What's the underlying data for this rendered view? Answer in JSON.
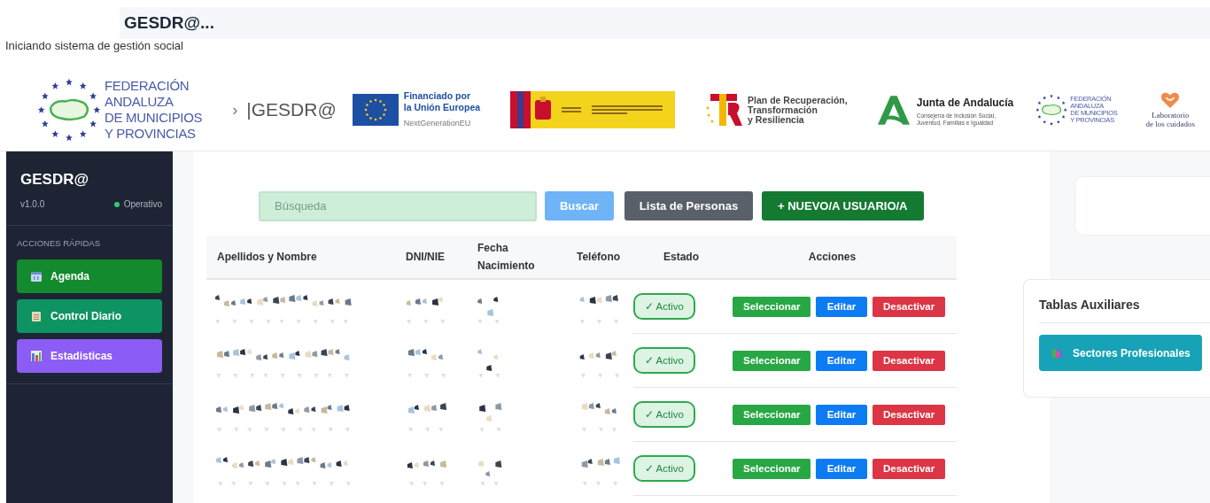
{
  "header": {
    "title": "GESDR@...",
    "subtitle": "Iniciando sistema de gestión social"
  },
  "logos": [
    {
      "kind": "famp",
      "lines": [
        "FEDERACIÓN",
        "ANDALUZA",
        "DE MUNICIPIOS",
        "Y PROVINCIAS"
      ]
    },
    {
      "kind": "brand",
      "separator": "›",
      "text": "|GESDR@"
    },
    {
      "kind": "eu",
      "lines": [
        "Financiado por",
        "la Unión Europea"
      ],
      "sub": "NextGenerationEU"
    },
    {
      "kind": "gobierno"
    },
    {
      "kind": "prtr",
      "lines": [
        "Plan de Recuperación,",
        "Transformación",
        "y Resiliencia"
      ]
    },
    {
      "kind": "junta",
      "title": "Junta de Andalucía",
      "lines": [
        "Consejería de Inclusión Social,",
        "Juventud, Familias e Igualdad"
      ]
    },
    {
      "kind": "famp_small",
      "lines": [
        "FEDERACIÓN",
        "ANDALUZA",
        "DE MUNICIPIOS",
        "Y PROVINCIAS"
      ]
    },
    {
      "kind": "lab",
      "lines": [
        "Laboratorio",
        "de los cuidados"
      ]
    }
  ],
  "sidebar": {
    "title": "GESDR@",
    "version": "v1.0.0",
    "status": "Operativo",
    "section": "ACCIONES RÁPIDAS",
    "actions": [
      {
        "label": "Agenda",
        "kind": "agenda"
      },
      {
        "label": "Control Diario",
        "kind": "control"
      },
      {
        "label": "Estadisticas",
        "kind": "stats"
      }
    ]
  },
  "toolbar": {
    "search": {
      "placeholder": "Búsqueda"
    },
    "buttons": [
      {
        "label": "Buscar",
        "kind": "search"
      },
      {
        "label": "Lista de Personas",
        "kind": "list"
      },
      {
        "label": "+ NUEVO/A USUARIO/A",
        "kind": "new"
      }
    ]
  },
  "table": {
    "columns": [
      "Apellidos y Nombre",
      "DNI/NIE",
      "Fecha Nacimiento",
      "Teléfono",
      "Estado",
      "Acciones"
    ],
    "rows": [
      {
        "status": "✓ Activo",
        "actions": [
          "Seleccionar",
          "Editar",
          "Desactivar"
        ]
      },
      {
        "status": "✓ Activo",
        "actions": [
          "Seleccionar",
          "Editar",
          "Desactivar"
        ]
      },
      {
        "status": "✓ Activo",
        "actions": [
          "Seleccionar",
          "Editar",
          "Desactivar"
        ]
      },
      {
        "status": "✓ Activo",
        "actions": [
          "Seleccionar",
          "Editar",
          "Desactivar"
        ]
      }
    ]
  },
  "aux": {
    "title": "Tablas Auxiliares",
    "buttons": [
      {
        "label": "Sectores Profesionales"
      }
    ]
  }
}
